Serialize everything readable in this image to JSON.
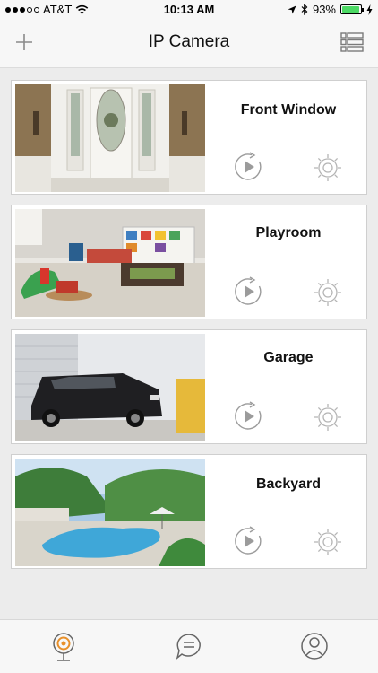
{
  "status_bar": {
    "carrier": "AT&T",
    "time": "10:13 AM",
    "battery": "93%",
    "battery_level": 0.93
  },
  "nav": {
    "title": "IP Camera"
  },
  "cameras": [
    {
      "name": "Front Window"
    },
    {
      "name": "Playroom"
    },
    {
      "name": "Garage"
    },
    {
      "name": "Backyard"
    }
  ],
  "colors": {
    "accent": "#e8902a",
    "icon_gray": "#9b9b9b"
  }
}
